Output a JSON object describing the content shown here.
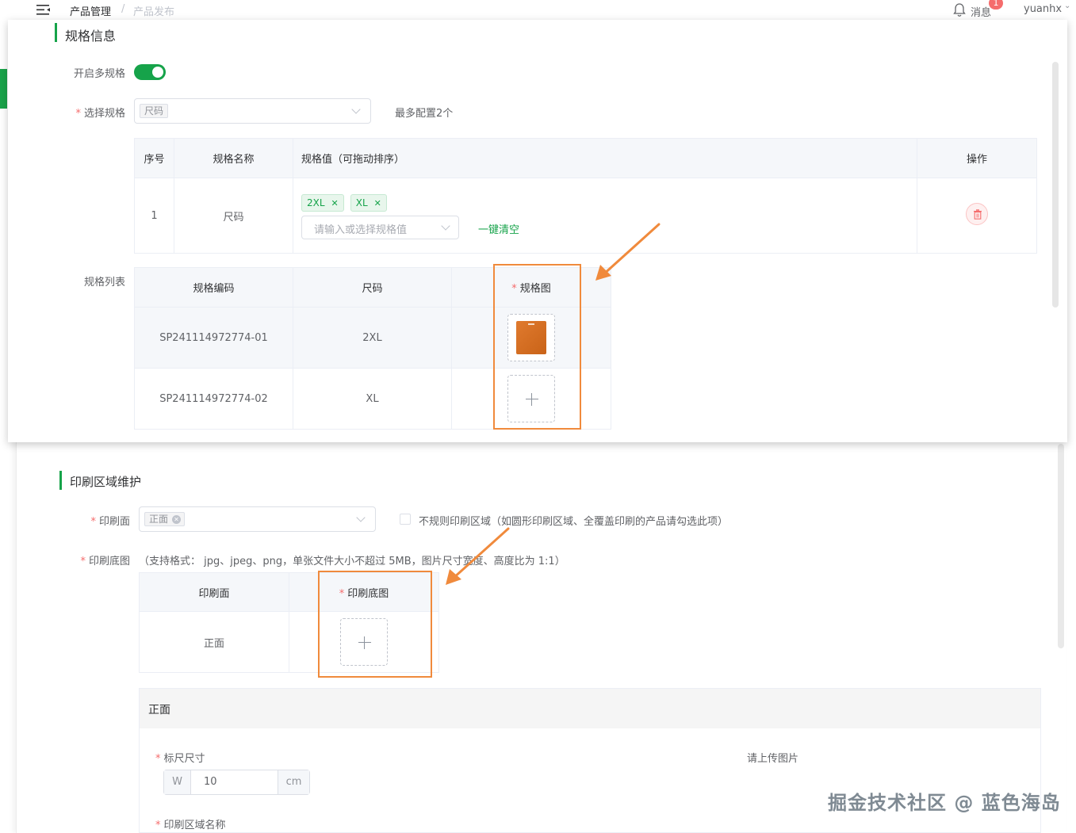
{
  "header": {
    "breadcrumb": [
      "产品管理",
      "产品发布"
    ],
    "breadcrumb_sep": "/",
    "messages_label": "消息",
    "messages_badge": "1",
    "username": "yuanhx"
  },
  "spec_section": {
    "title": "规格信息",
    "multi_spec_label": "开启多规格",
    "multi_spec_enabled": true,
    "select_spec_label": "选择规格",
    "selected_spec_chip": "尺码",
    "max_hint": "最多配置2个",
    "spec_table": {
      "headers": [
        "序号",
        "规格名称",
        "规格值（可拖动排序）",
        "操作"
      ],
      "rows": [
        {
          "index": "1",
          "name": "尺码",
          "tags": [
            "2XL",
            "XL"
          ],
          "value_placeholder": "请输入或选择规格值",
          "clear_link": "一键清空"
        }
      ]
    },
    "spec_list_label": "规格列表",
    "list_table": {
      "headers": [
        "规格编码",
        "尺码",
        "规格图"
      ],
      "rows": [
        {
          "code": "SP241114972774-01",
          "size": "2XL",
          "has_image": true
        },
        {
          "code": "SP241114972774-02",
          "size": "XL",
          "has_image": false
        }
      ]
    }
  },
  "print_section": {
    "title": "印刷区域维护",
    "print_face_label": "印刷面",
    "print_face_chip": "正面",
    "irregular_label": "不规则印刷区域（如圆形印刷区域、全覆盖印刷的产品请勾选此项）",
    "base_image_label": "印刷底图",
    "base_image_hint": "（支持格式： jpg、jpeg、png，单张文件大小不超过 5MB，图片尺寸宽度、高度比为 1:1）",
    "table": {
      "headers": [
        "印刷面",
        "印刷底图"
      ],
      "rows": [
        {
          "face": "正面"
        }
      ]
    },
    "sub_card": {
      "title": "正面",
      "ruler_label": "标尺尺寸",
      "ruler_prefix": "W",
      "ruler_value": "10",
      "ruler_unit": "cm",
      "upload_hint": "请上传图片",
      "area_name_label": "印刷区域名称"
    }
  },
  "watermark": "掘金技术社区 @ 蓝色海岛",
  "colors": {
    "brand_green": "#16a34a",
    "annotation_orange": "#f08a3c",
    "danger": "#f56c6c"
  }
}
